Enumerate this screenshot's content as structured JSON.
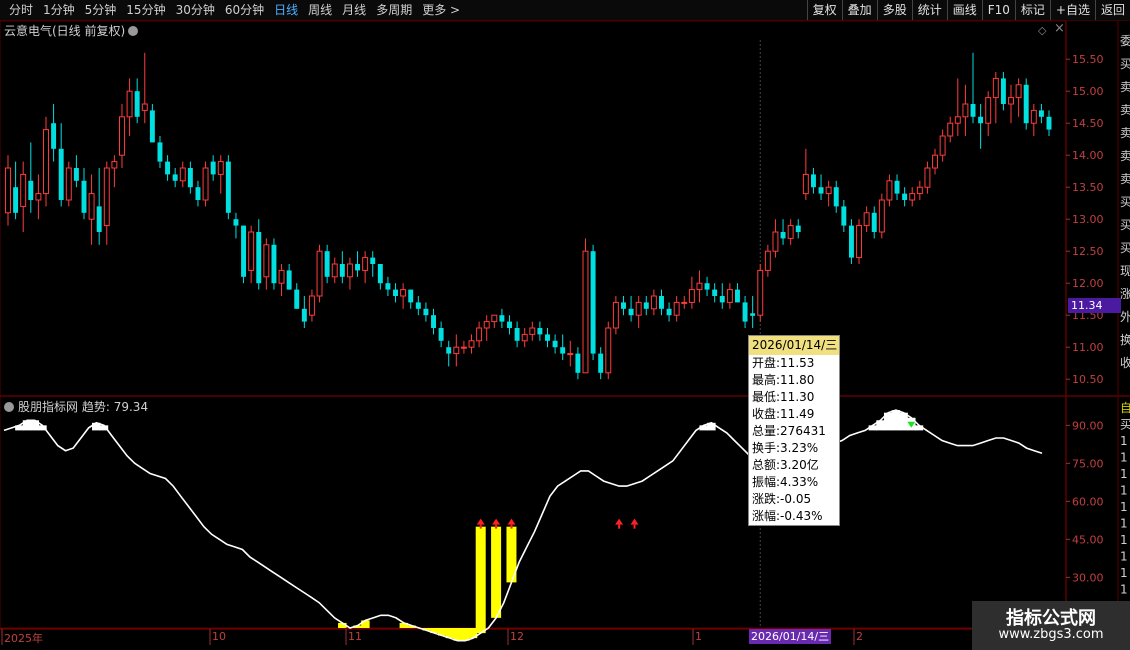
{
  "toolbar": {
    "periods": [
      "分时",
      "1分钟",
      "5分钟",
      "15分钟",
      "30分钟",
      "60分钟",
      "日线",
      "周线",
      "月线",
      "多周期",
      "更多 >"
    ],
    "active_period": "日线",
    "right_buttons": [
      "复权",
      "叠加",
      "多股",
      "统计",
      "画线",
      "F10",
      "标记",
      "+自选",
      "返回"
    ]
  },
  "price_panel": {
    "title": "云意电气(日线 前复权)",
    "price_ticks": [
      "15.50",
      "15.00",
      "14.50",
      "14.00",
      "13.50",
      "13.00",
      "12.50",
      "12.00",
      "11.50",
      "11.00",
      "10.50"
    ],
    "current_price_label": "11.34",
    "right_side_glyphs": [
      "委",
      "买",
      "卖",
      "卖",
      "卖",
      "卖",
      "卖",
      "买",
      "买",
      "买",
      "现",
      "涨",
      "外",
      "换",
      "收"
    ]
  },
  "indicator_panel": {
    "name": "股朋指标网",
    "value_label": "趋势:",
    "value": "79.34",
    "ticks": [
      "90.00",
      "75.00",
      "60.00",
      "45.00",
      "30.00",
      "15.00"
    ],
    "right_side_glyphs": [
      "自",
      "买",
      "1",
      "1",
      "1",
      "1",
      "1",
      "1",
      "1",
      "1",
      "1",
      "1",
      "1",
      "1"
    ]
  },
  "tooltip": {
    "date": "2026/01/14/三",
    "rows": [
      "开盘:11.53",
      "最高:11.80",
      "最低:11.30",
      "收盘:11.49",
      "总量:276431",
      "换手:3.23%",
      "总额:3.20亿",
      "振幅:4.33%",
      "涨跌:-0.05",
      "涨幅:-0.43%"
    ]
  },
  "date_axis": {
    "labels": [
      "2025年",
      "10",
      "11",
      "12",
      "1",
      "2"
    ],
    "cursor_date": "2026/01/14/三"
  },
  "watermark": {
    "title": "指标公式网",
    "url": "www.zbgs3.com"
  },
  "colors": {
    "up": "#ff3c3c",
    "down": "#00e0e0",
    "line": "#ffffff",
    "signal": "#ffff00",
    "grid": "#5a0000"
  },
  "chart_data": {
    "type": "candlestick",
    "price_range": [
      10.3,
      15.8
    ],
    "indicator_range": [
      10,
      100
    ],
    "candles": [
      [
        13.1,
        14.0,
        12.9,
        13.8
      ],
      [
        13.5,
        13.9,
        13.0,
        13.1
      ],
      [
        13.2,
        13.9,
        12.8,
        13.7
      ],
      [
        13.6,
        14.2,
        13.1,
        13.3
      ],
      [
        13.3,
        13.7,
        13.0,
        13.4
      ],
      [
        13.4,
        14.6,
        13.2,
        14.4
      ],
      [
        14.5,
        14.8,
        13.9,
        14.1
      ],
      [
        14.1,
        14.5,
        13.2,
        13.3
      ],
      [
        13.3,
        13.9,
        13.2,
        13.8
      ],
      [
        13.8,
        14.0,
        13.5,
        13.6
      ],
      [
        13.6,
        13.8,
        13.0,
        13.1
      ],
      [
        13.0,
        13.7,
        12.6,
        13.4
      ],
      [
        13.2,
        13.8,
        12.6,
        12.8
      ],
      [
        12.9,
        13.9,
        12.6,
        13.8
      ],
      [
        13.8,
        14.0,
        13.5,
        13.9
      ],
      [
        14.0,
        14.8,
        13.8,
        14.6
      ],
      [
        14.6,
        15.2,
        14.3,
        15.0
      ],
      [
        15.0,
        15.2,
        14.5,
        14.6
      ],
      [
        14.7,
        15.6,
        14.5,
        14.8
      ],
      [
        14.7,
        14.8,
        14.2,
        14.2
      ],
      [
        14.2,
        14.3,
        13.8,
        13.9
      ],
      [
        13.9,
        14.0,
        13.6,
        13.7
      ],
      [
        13.7,
        13.8,
        13.5,
        13.6
      ],
      [
        13.6,
        13.9,
        13.5,
        13.8
      ],
      [
        13.8,
        13.9,
        13.4,
        13.5
      ],
      [
        13.5,
        13.6,
        13.2,
        13.3
      ],
      [
        13.3,
        13.9,
        13.2,
        13.8
      ],
      [
        13.9,
        14.0,
        13.6,
        13.7
      ],
      [
        13.7,
        14.0,
        13.4,
        13.9
      ],
      [
        13.9,
        14.0,
        13.0,
        13.1
      ],
      [
        13.0,
        13.1,
        12.7,
        12.9
      ],
      [
        12.9,
        12.9,
        12.0,
        12.1
      ],
      [
        12.2,
        12.9,
        12.0,
        12.8
      ],
      [
        12.8,
        13.0,
        11.9,
        12.0
      ],
      [
        12.1,
        12.7,
        11.9,
        12.6
      ],
      [
        12.6,
        12.7,
        11.9,
        12.0
      ],
      [
        12.0,
        12.3,
        11.8,
        12.2
      ],
      [
        12.2,
        12.3,
        11.9,
        11.9
      ],
      [
        11.9,
        12.0,
        11.6,
        11.6
      ],
      [
        11.6,
        11.8,
        11.3,
        11.4
      ],
      [
        11.5,
        11.9,
        11.4,
        11.8
      ],
      [
        11.8,
        12.6,
        11.7,
        12.5
      ],
      [
        12.5,
        12.6,
        12.0,
        12.1
      ],
      [
        12.1,
        12.4,
        12.0,
        12.3
      ],
      [
        12.3,
        12.5,
        12.0,
        12.1
      ],
      [
        12.1,
        12.4,
        11.9,
        12.3
      ],
      [
        12.3,
        12.5,
        12.1,
        12.2
      ],
      [
        12.2,
        12.5,
        12.0,
        12.4
      ],
      [
        12.4,
        12.5,
        12.1,
        12.3
      ],
      [
        12.3,
        12.3,
        11.9,
        12.0
      ],
      [
        12.0,
        12.1,
        11.8,
        11.9
      ],
      [
        11.9,
        12.0,
        11.7,
        11.8
      ],
      [
        11.8,
        12.0,
        11.6,
        11.9
      ],
      [
        11.9,
        11.9,
        11.6,
        11.7
      ],
      [
        11.7,
        11.8,
        11.5,
        11.6
      ],
      [
        11.6,
        11.7,
        11.4,
        11.5
      ],
      [
        11.5,
        11.6,
        11.2,
        11.3
      ],
      [
        11.3,
        11.4,
        11.0,
        11.1
      ],
      [
        11.0,
        11.1,
        10.7,
        10.9
      ],
      [
        10.9,
        11.2,
        10.7,
        11.0
      ],
      [
        11.0,
        11.1,
        10.9,
        11.0
      ],
      [
        11.0,
        11.2,
        10.9,
        11.1
      ],
      [
        11.1,
        11.4,
        11.0,
        11.3
      ],
      [
        11.3,
        11.5,
        11.1,
        11.4
      ],
      [
        11.4,
        11.5,
        11.3,
        11.5
      ],
      [
        11.5,
        11.6,
        11.3,
        11.4
      ],
      [
        11.4,
        11.5,
        11.2,
        11.3
      ],
      [
        11.3,
        11.4,
        11.0,
        11.1
      ],
      [
        11.1,
        11.3,
        11.0,
        11.2
      ],
      [
        11.2,
        11.4,
        11.1,
        11.3
      ],
      [
        11.3,
        11.4,
        11.1,
        11.2
      ],
      [
        11.2,
        11.3,
        11.0,
        11.1
      ],
      [
        11.1,
        11.2,
        10.9,
        11.0
      ],
      [
        11.0,
        11.2,
        10.8,
        10.9
      ],
      [
        10.9,
        11.1,
        10.7,
        10.9
      ],
      [
        10.9,
        11.0,
        10.5,
        10.6
      ],
      [
        10.6,
        12.7,
        10.6,
        12.5
      ],
      [
        12.5,
        12.6,
        10.8,
        10.9
      ],
      [
        10.9,
        11.0,
        10.5,
        10.6
      ],
      [
        10.6,
        11.4,
        10.5,
        11.3
      ],
      [
        11.3,
        11.8,
        11.2,
        11.7
      ],
      [
        11.7,
        11.8,
        11.5,
        11.6
      ],
      [
        11.6,
        11.8,
        11.4,
        11.5
      ],
      [
        11.5,
        11.8,
        11.3,
        11.7
      ],
      [
        11.7,
        11.8,
        11.5,
        11.6
      ],
      [
        11.6,
        11.9,
        11.5,
        11.8
      ],
      [
        11.8,
        11.9,
        11.5,
        11.6
      ],
      [
        11.6,
        11.7,
        11.4,
        11.5
      ],
      [
        11.5,
        11.8,
        11.4,
        11.7
      ],
      [
        11.7,
        11.8,
        11.6,
        11.7
      ],
      [
        11.7,
        12.1,
        11.6,
        11.9
      ],
      [
        11.9,
        12.2,
        11.7,
        12.0
      ],
      [
        12.0,
        12.1,
        11.8,
        11.9
      ],
      [
        11.9,
        12.0,
        11.7,
        11.8
      ],
      [
        11.8,
        12.0,
        11.6,
        11.7
      ],
      [
        11.7,
        12.0,
        11.6,
        11.9
      ],
      [
        11.9,
        12.0,
        11.7,
        11.7
      ],
      [
        11.7,
        11.8,
        11.3,
        11.4
      ],
      [
        11.53,
        11.8,
        11.3,
        11.49
      ],
      [
        11.5,
        12.3,
        11.4,
        12.2
      ],
      [
        12.2,
        12.6,
        12.1,
        12.5
      ],
      [
        12.5,
        13.0,
        12.4,
        12.8
      ],
      [
        12.8,
        13.0,
        12.6,
        12.7
      ],
      [
        12.7,
        13.0,
        12.6,
        12.9
      ],
      [
        12.9,
        13.0,
        12.7,
        12.8
      ],
      [
        13.4,
        14.1,
        13.3,
        13.7
      ],
      [
        13.7,
        13.8,
        13.4,
        13.5
      ],
      [
        13.5,
        13.7,
        13.3,
        13.4
      ],
      [
        13.4,
        13.6,
        13.2,
        13.5
      ],
      [
        13.5,
        13.6,
        13.1,
        13.2
      ],
      [
        13.2,
        13.3,
        12.8,
        12.9
      ],
      [
        12.9,
        13.0,
        12.3,
        12.4
      ],
      [
        12.4,
        13.0,
        12.3,
        12.9
      ],
      [
        12.9,
        13.2,
        12.8,
        13.1
      ],
      [
        13.1,
        13.2,
        12.7,
        12.8
      ],
      [
        12.8,
        13.4,
        12.7,
        13.3
      ],
      [
        13.3,
        13.7,
        13.2,
        13.6
      ],
      [
        13.6,
        13.7,
        13.3,
        13.4
      ],
      [
        13.4,
        13.5,
        13.2,
        13.3
      ],
      [
        13.3,
        13.5,
        13.2,
        13.4
      ],
      [
        13.4,
        13.6,
        13.3,
        13.5
      ],
      [
        13.5,
        13.9,
        13.4,
        13.8
      ],
      [
        13.8,
        14.1,
        13.7,
        14.0
      ],
      [
        14.0,
        14.4,
        13.9,
        14.3
      ],
      [
        14.3,
        14.6,
        14.2,
        14.5
      ],
      [
        14.5,
        15.2,
        14.3,
        14.6
      ],
      [
        14.6,
        15.1,
        14.3,
        14.8
      ],
      [
        14.8,
        15.6,
        14.5,
        14.6
      ],
      [
        14.6,
        14.8,
        14.1,
        14.5
      ],
      [
        14.5,
        15.0,
        14.3,
        14.9
      ],
      [
        14.9,
        15.3,
        14.5,
        15.2
      ],
      [
        15.2,
        15.3,
        14.7,
        14.8
      ],
      [
        14.8,
        15.1,
        14.5,
        14.9
      ],
      [
        14.9,
        15.2,
        14.6,
        15.1
      ],
      [
        15.1,
        15.2,
        14.4,
        14.5
      ],
      [
        14.5,
        14.8,
        14.3,
        14.7
      ],
      [
        14.7,
        14.8,
        14.5,
        14.6
      ],
      [
        14.6,
        14.7,
        14.3,
        14.4
      ]
    ],
    "trend": [
      88,
      89,
      90,
      92,
      92,
      90,
      86,
      82,
      80,
      81,
      85,
      89,
      91,
      90,
      86,
      82,
      78,
      75,
      73,
      71,
      70,
      69,
      66,
      62,
      58,
      54,
      50,
      47,
      45,
      43,
      42,
      41,
      38,
      36,
      34,
      32,
      30,
      28,
      26,
      24,
      22,
      20,
      17,
      14,
      12,
      10,
      11,
      13,
      14,
      15,
      15,
      14,
      12,
      11,
      10,
      9,
      8,
      7,
      6,
      5,
      5,
      6,
      8,
      10,
      14,
      20,
      28,
      36,
      42,
      48,
      55,
      62,
      66,
      68,
      70,
      72,
      72,
      70,
      68,
      67,
      66,
      66,
      67,
      68,
      70,
      72,
      74,
      76,
      80,
      84,
      88,
      90,
      91,
      89,
      87,
      84,
      81,
      78,
      76,
      74,
      72,
      72,
      71,
      70,
      72,
      75,
      78,
      81,
      83,
      84,
      86,
      87,
      88,
      90,
      92,
      95,
      96,
      95,
      93,
      90,
      88,
      86,
      84,
      83,
      82,
      82,
      82,
      83,
      84,
      85,
      85,
      84,
      83,
      81,
      80,
      79
    ],
    "signal_bars": [
      62,
      64,
      66,
      80,
      82
    ]
  }
}
